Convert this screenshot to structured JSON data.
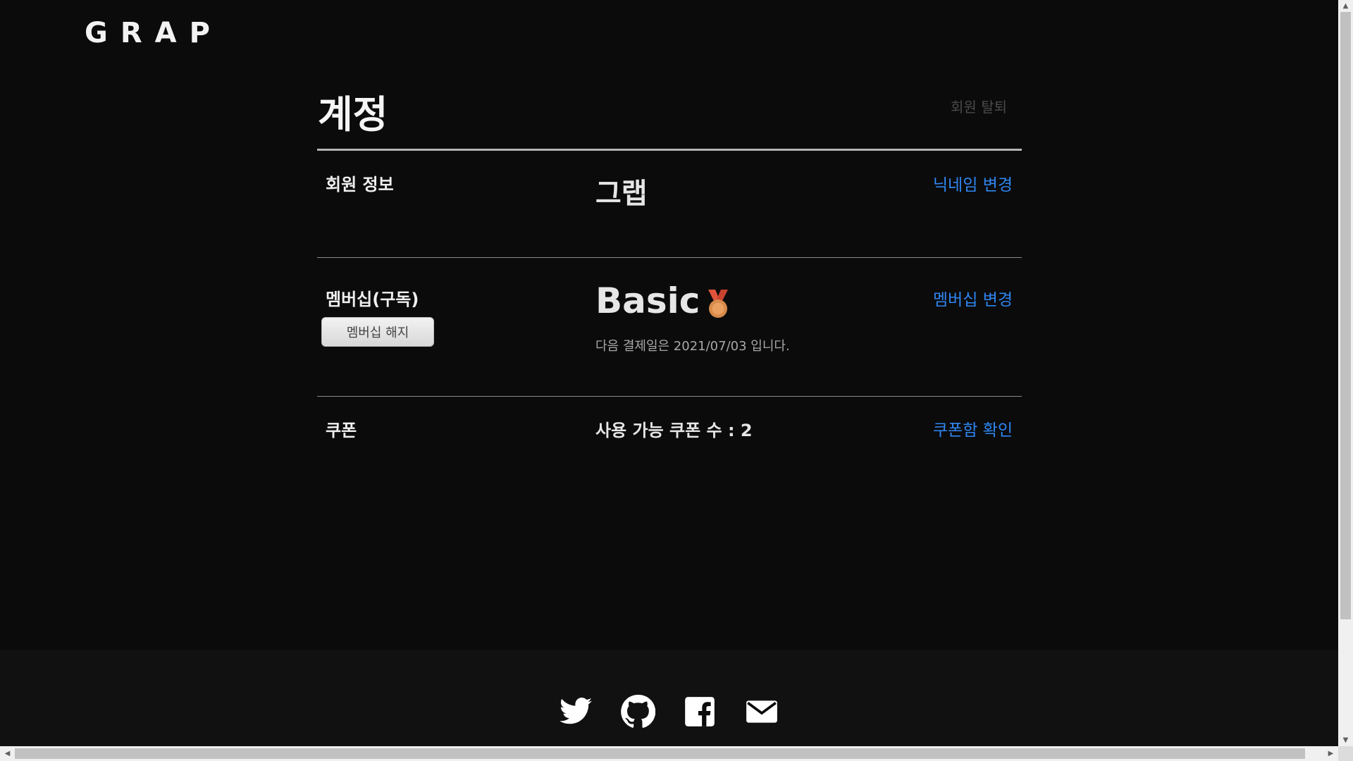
{
  "header": {
    "logo": "GRAP"
  },
  "account": {
    "title": "계정",
    "withdraw_label": "회원 탈퇴"
  },
  "member_info": {
    "label": "회원 정보",
    "nickname": "그랩",
    "change_link": "닉네임 변경"
  },
  "membership": {
    "label": "멤버십(구독)",
    "cancel_button": "멤버십 해지",
    "plan": "Basic",
    "plan_icon": "bronze-medal-icon",
    "next_payment": "다음 결제일은 2021/07/03 입니다.",
    "change_link": "멤버십 변경"
  },
  "coupon": {
    "label": "쿠폰",
    "available": "사용 가능 쿠폰 수 : 2",
    "check_link": "쿠폰함 확인"
  },
  "footer": {
    "icons": [
      "twitter-icon",
      "github-icon",
      "facebook-icon",
      "mail-icon"
    ]
  },
  "colors": {
    "background": "#0b0b0c",
    "link": "#2f86f0",
    "medal_ribbon": "#e0533b",
    "medal": "#d88a4a"
  }
}
